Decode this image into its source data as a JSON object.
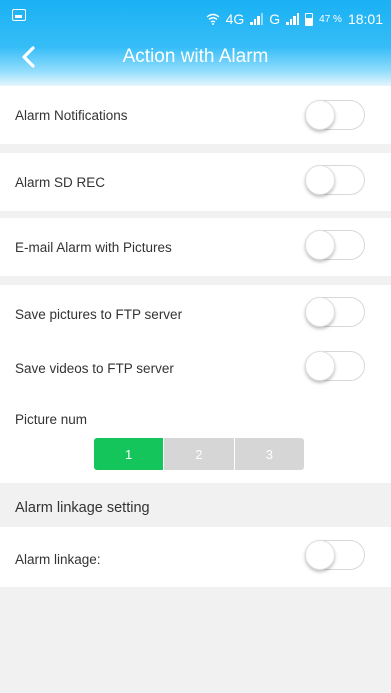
{
  "status_bar": {
    "network_4g": "4G",
    "network_g": "G",
    "battery_percent": "47",
    "percent_sign": "%",
    "time": "18:01"
  },
  "nav": {
    "title": "Action with Alarm"
  },
  "settings": {
    "alarm_notifications": {
      "label": "Alarm Notifications",
      "enabled": false
    },
    "alarm_sd_rec": {
      "label": "Alarm SD REC",
      "enabled": false
    },
    "email_alarm": {
      "label": "E-mail Alarm with Pictures",
      "enabled": false
    },
    "ftp_pictures": {
      "label": "Save pictures to FTP server",
      "enabled": false
    },
    "ftp_videos": {
      "label": "Save videos to FTP server",
      "enabled": false
    },
    "picture_num": {
      "label": "Picture num",
      "options": [
        "1",
        "2",
        "3"
      ],
      "selected": "1"
    }
  },
  "linkage": {
    "section_label": "Alarm linkage setting",
    "alarm_linkage": {
      "label": "Alarm linkage:",
      "enabled": false
    }
  },
  "colors": {
    "header_blue": "#19b1f4",
    "selected_green": "#13c55b",
    "segment_gray": "#d6d6d6"
  }
}
